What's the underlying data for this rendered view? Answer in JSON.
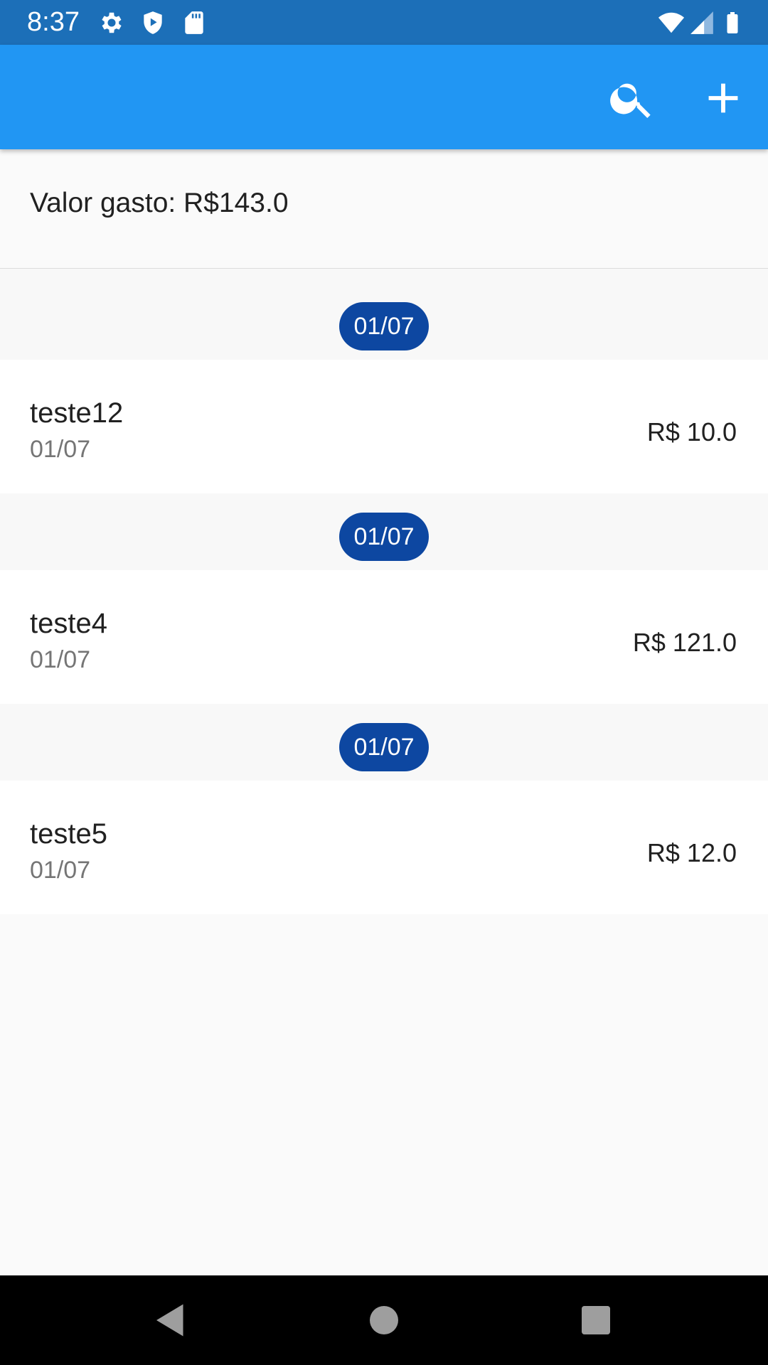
{
  "status_bar": {
    "time": "8:37",
    "icons": [
      "gear-icon",
      "shield-play-icon",
      "sd-card-icon",
      "wifi-icon",
      "signal-icon",
      "battery-icon"
    ]
  },
  "app_bar": {
    "actions": [
      "search-icon",
      "add-icon"
    ],
    "color": "#2196f3"
  },
  "summary": {
    "text": "Valor gasto: R$143.0"
  },
  "groups": [
    {
      "date": "01/07",
      "items": [
        {
          "title": "teste12",
          "subtitle": "01/07",
          "value": "R$ 10.0"
        }
      ]
    },
    {
      "date": "01/07",
      "items": [
        {
          "title": "teste4",
          "subtitle": "01/07",
          "value": "R$ 121.0"
        }
      ]
    },
    {
      "date": "01/07",
      "items": [
        {
          "title": "teste5",
          "subtitle": "01/07",
          "value": "R$ 12.0"
        }
      ]
    }
  ],
  "nav_bar": {
    "buttons": [
      "back-icon",
      "home-icon",
      "recents-icon"
    ]
  },
  "colors": {
    "status_bar": "#1c6fb8",
    "app_bar": "#2196f3",
    "date_chip": "#0d47a1",
    "background": "#fafafa"
  }
}
